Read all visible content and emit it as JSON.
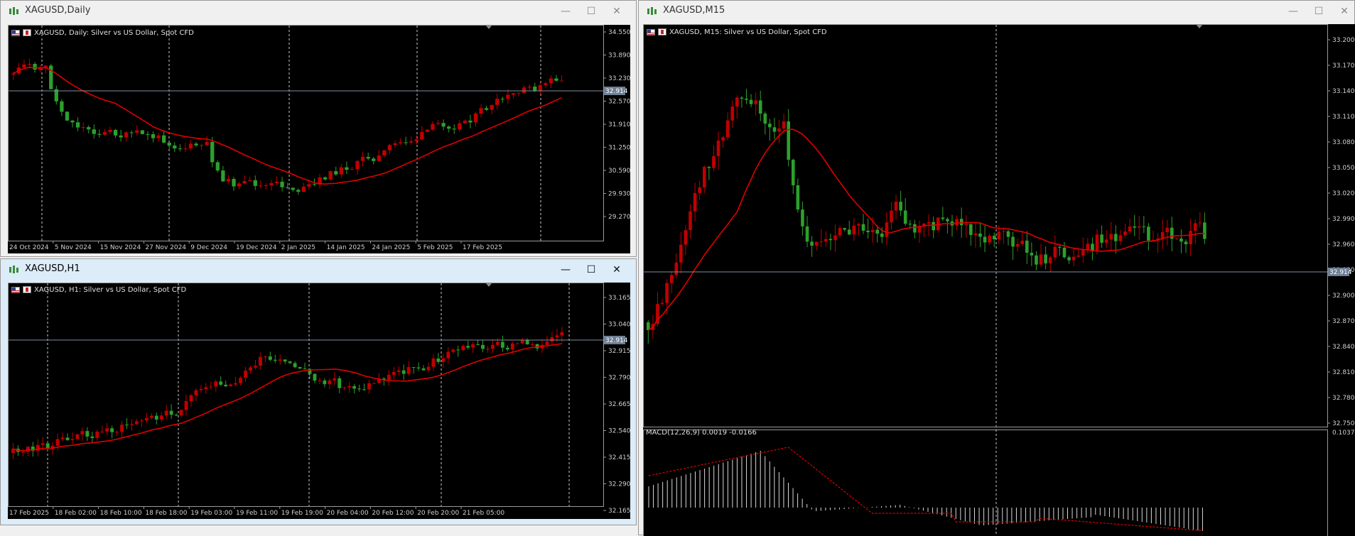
{
  "windows": {
    "daily": {
      "title": "XAGUSD,Daily",
      "label": "XAGUSD, Daily:  Silver vs US Dollar, Spot CFD",
      "current_price_label": "32.914",
      "price_ticks": [
        "34.550",
        "33.890",
        "33.230",
        "32.570",
        "31.910",
        "31.250",
        "30.590",
        "29.930",
        "29.270"
      ],
      "date_ticks": [
        "24 Oct 2024",
        "5 Nov 2024",
        "15 Nov 2024",
        "27 Nov 2024",
        "9 Dec 2024",
        "19 Dec 2024",
        "2 Jan 2025",
        "14 Jan 2025",
        "24 Jan 2025",
        "5 Feb 2025",
        "17 Feb 2025"
      ]
    },
    "h1": {
      "title": "XAGUSD,H1",
      "label": "XAGUSD, H1:  Silver vs US Dollar, Spot CFD",
      "current_price_label": "32.914",
      "price_ticks": [
        "33.165",
        "33.040",
        "32.915",
        "32.790",
        "32.665",
        "32.540",
        "32.415",
        "32.290",
        "32.165"
      ],
      "date_ticks": [
        "17 Feb 2025",
        "18 Feb 02:00",
        "18 Feb 10:00",
        "18 Feb 18:00",
        "19 Feb 03:00",
        "19 Feb 11:00",
        "19 Feb 19:00",
        "20 Feb 04:00",
        "20 Feb 12:00",
        "20 Feb 20:00",
        "21 Feb 05:00"
      ]
    },
    "m15": {
      "title": "XAGUSD,M15",
      "label": "XAGUSD, M15:  Silver vs US Dollar, Spot CFD",
      "current_price_label": "32.914",
      "price_ticks": [
        "33.200",
        "33.170",
        "33.140",
        "33.110",
        "33.080",
        "33.050",
        "33.020",
        "32.990",
        "32.960",
        "32.930",
        "32.900",
        "32.870",
        "32.840",
        "32.810",
        "32.780",
        "32.750"
      ],
      "macd_label": "MACD(12,26,9) 0.0019 -0.0166",
      "macd_tick": "0.1037"
    }
  },
  "window_controls": {
    "minimize": "—",
    "maximize": "☐",
    "close": "✕"
  },
  "colors": {
    "bull": "#2ca02c",
    "bear": "#c00000",
    "ma": "#e00000",
    "grid": "#ffffff",
    "price_line": "#7f8ea0"
  }
}
